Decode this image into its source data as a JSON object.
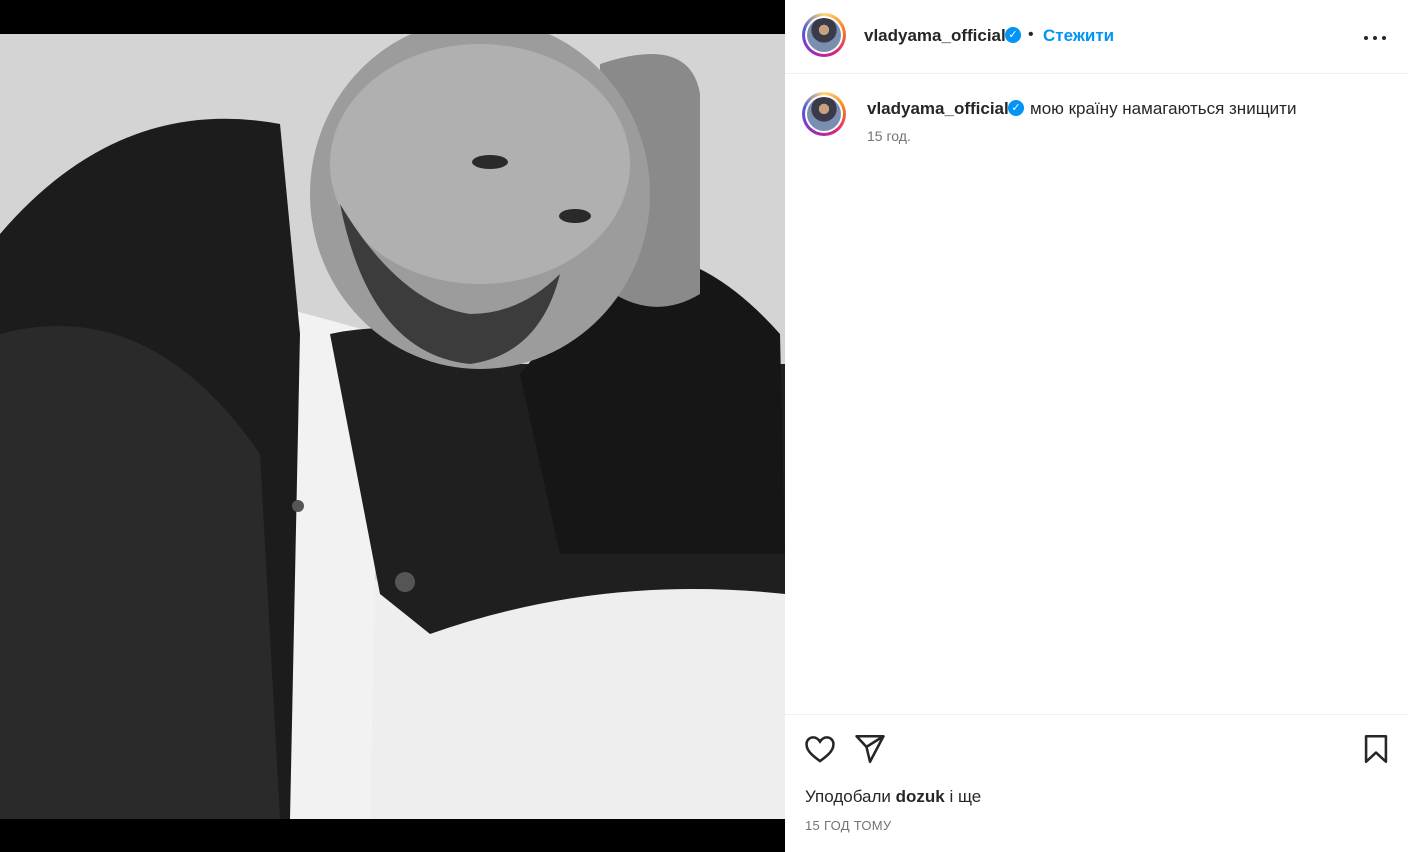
{
  "post": {
    "image_alt": "Black-and-white portrait of a bald bearded man in a dark leather jacket, resting his head on his hand"
  },
  "header": {
    "username": "vladyama_official",
    "verified_mark": "✓",
    "separator": "•",
    "follow_label": "Стежити",
    "more_icon": "more-horizontal-icon"
  },
  "caption": {
    "username": "vladyama_official",
    "verified_mark": "✓",
    "text": "мою країну намагаються знищити",
    "time": "15 год."
  },
  "actions": {
    "like_icon": "heart-icon",
    "share_icon": "send-icon",
    "save_icon": "bookmark-icon",
    "likes_prefix": "Уподобали",
    "likes_user": "dozuk",
    "likes_suffix": "і ще",
    "post_time": "15 ГОД ТОМУ"
  },
  "colors": {
    "accent": "#0095f6",
    "text": "#262626",
    "muted": "#737373"
  }
}
